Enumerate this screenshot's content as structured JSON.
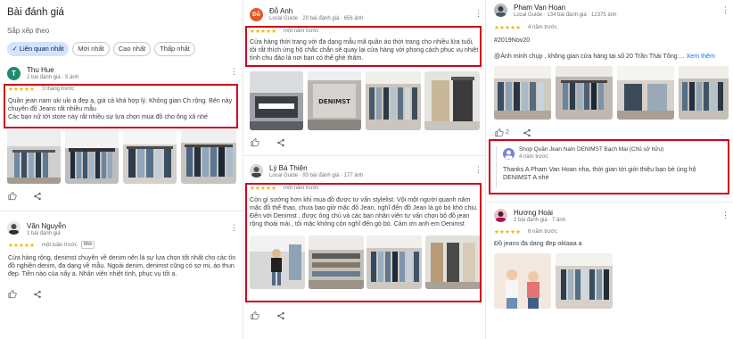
{
  "col1": {
    "title": "Bài đánh giá",
    "sort_label": "Sắp xếp theo",
    "chips": [
      {
        "label": "✓ Liên quan nhất",
        "active": true
      },
      {
        "label": "Mới nhất",
        "active": false
      },
      {
        "label": "Cao nhất",
        "active": false
      },
      {
        "label": "Thấp nhất",
        "active": false
      }
    ],
    "review1": {
      "initial": "T",
      "name": "Thu Hue",
      "meta": "2 bài đánh giá · 5 ảnh",
      "stars": "★★★★★",
      "when": "3 tháng trước",
      "text": "Quần jean nam uki uki a đẹp ạ, giá cả khá hợp lý. Không gian Ch rộng. Bên này chuyên đồ Jeans rất nhiều mẫu\nCác bạn nữ tới store này rất nhiều sự lựa chọn mua đồ cho ông xã nhé"
    },
    "review2": {
      "initial": "V",
      "name": "Văn Nguyễn",
      "meta": "1 bài đánh giá",
      "stars": "★★★★★",
      "when": "một tuần trước",
      "badge": "Mới",
      "text": "Cửa hàng rộng, denimst chuyên về denim nên là sự lựa chọn tốt nhất cho các tín đồ nghiện denim, đa dạng về mẫu. Ngoài denim, denimst cũng có sơ mi, áo thun đẹp. Tiền nào của nấy a. Nhân viên nhiệt tình, phục vụ tốt a."
    }
  },
  "col2": {
    "review1": {
      "initial": "Đỗ",
      "name": "Đỗ Anh",
      "meta": "Local Guide · 20 bài đánh giá · 656 ảnh",
      "stars": "★★★★★",
      "when": "một năm trước",
      "text": "Cửa hàng thời trang với đa dạng mẫu mã quần áo thời trang cho nhiều lứa tuổi, tôi rất thích ứng hộ chắc chắn sẽ quay lại cửa hàng với phong cách phục vụ nhiệt tình chu đáo là nơi bạn có thể ghé thăm.",
      "sign": "DENIMST"
    },
    "review2": {
      "initial": "L",
      "name": "Lý Bá Thiện",
      "meta": "Local Guide · 93 bài đánh giá · 177 ảnh",
      "stars": "★★★★★",
      "when": "một năm trước",
      "text": "Còn gì sướng hơn khi mua đồ được tư vấn stylelist. Vội một người quanh năm mặc đồ thể thao, chưa bao giờ mặc đồ Jean, nghĩ đến đồ Jean là gò bó khó chịu. Đến với Denimst , được ông chủ và các bạn nhân viên tư vấn chọn bộ đồ jean rộng thoải mái , tôi mặc không còn nghĩ đến gò bó. Cảm ơn anh em Denimst"
    }
  },
  "col3": {
    "review1": {
      "name": "Pham Van Hoan",
      "meta": "Local Guide · 134 bài đánh giá · 12375 ảnh",
      "stars": "★★★★★",
      "when": "4 năm trước",
      "hashtag": "#2019Nov20",
      "text": "@Ảnh minh chụp , không gian cửa hàng tại số 20 Trần Thái Tông ... ",
      "more": "Xem thêm",
      "likes": "2"
    },
    "owner_reply": {
      "name": "Shop Quần Jean Nam DENIMST Bạch Mai (Chủ sở hữu)",
      "when": "4 năm trước",
      "text": "Thanks A Pham Van Hoan nha, thời gian tới giới thiệu bạn bè ủng hộ DENIMST A nhé"
    },
    "review2": {
      "name": "Hương Hoài",
      "meta": "2 bài đánh giá · 7 ảnh",
      "stars": "★★★★★",
      "when": "6 năm trước",
      "text": "Đồ jeans đa dang đep oktaaa a"
    }
  },
  "colors": {
    "highlight": "#d0021b",
    "star": "#f4b400",
    "chip_active": "#d3e3fd",
    "link": "#1a73e8"
  }
}
